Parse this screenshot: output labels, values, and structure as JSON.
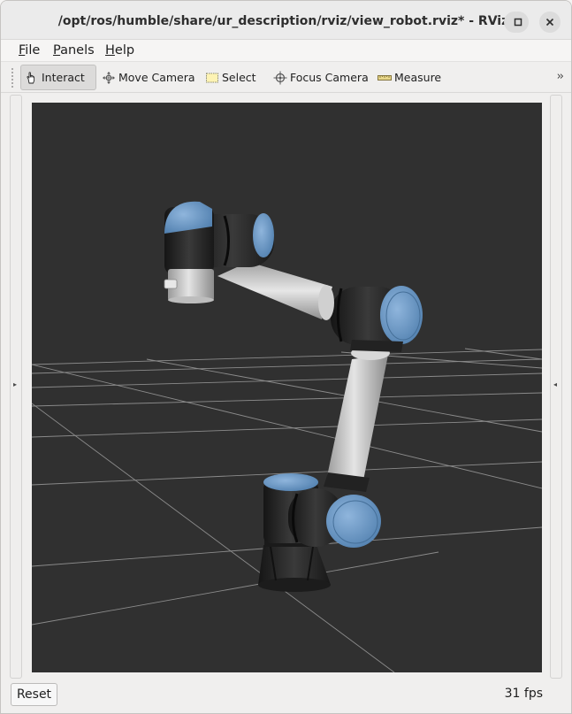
{
  "window": {
    "title": "/opt/ros/humble/share/ur_description/rviz/view_robot.rviz* - RViz",
    "controls": {
      "minimize_icon": "minimize-icon",
      "maximize_icon": "maximize-icon",
      "close_icon": "close-icon"
    }
  },
  "menubar": {
    "items": [
      {
        "accel": "F",
        "rest": "ile"
      },
      {
        "accel": "P",
        "rest": "anels"
      },
      {
        "accel": "H",
        "rest": "elp"
      }
    ]
  },
  "toolbar": {
    "tools": [
      {
        "label": "Interact",
        "icon": "hand-pointer-icon",
        "active": true
      },
      {
        "label": "Move Camera",
        "icon": "move-camera-icon",
        "active": false
      },
      {
        "label": "Select",
        "icon": "select-rect-icon",
        "active": false
      },
      {
        "label": "Focus Camera",
        "icon": "focus-camera-icon",
        "active": false
      },
      {
        "label": "Measure",
        "icon": "ruler-icon",
        "active": false
      }
    ],
    "overflow": "››"
  },
  "viewport": {
    "background": "#303030",
    "grid_color": "#a0a0a0",
    "robot_accent": "#6a9ac8"
  },
  "panels": {
    "left_toggle": "▸",
    "right_toggle": "◂"
  },
  "statusbar": {
    "reset_label": "Reset",
    "fps": "31 fps"
  }
}
